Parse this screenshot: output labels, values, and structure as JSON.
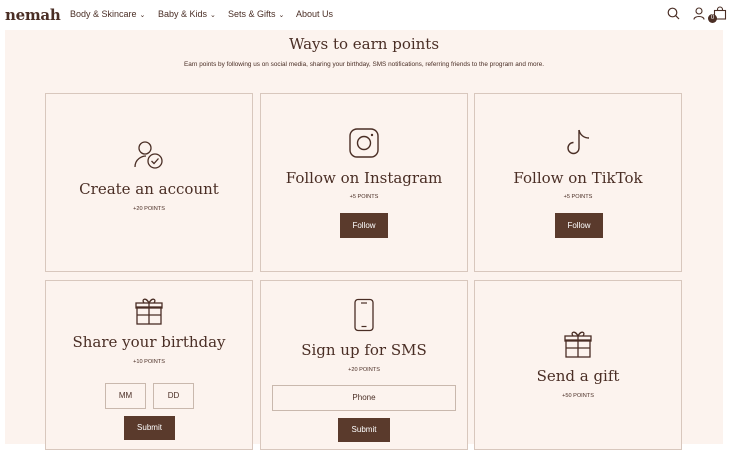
{
  "header": {
    "logo": "nemah",
    "nav": [
      {
        "label": "Body & Skincare",
        "chevron": "⌄"
      },
      {
        "label": "Baby & Kids",
        "chevron": "⌄"
      },
      {
        "label": "Sets & Gifts",
        "chevron": "⌄"
      },
      {
        "label": "About Us"
      }
    ],
    "icons": [
      "search-icon",
      "account-icon",
      "bag-icon"
    ],
    "cart_count": "0"
  },
  "main": {
    "title": "Ways to earn points",
    "subtitle": "Earn points by following us on social media, sharing your birthday, SMS notifications, referring friends to the program and more."
  },
  "cards": {
    "account": {
      "title": "Create an account",
      "points": "+20 POINTS",
      "icon": "user-check-icon"
    },
    "instagram": {
      "title": "Follow on Instagram",
      "points": "+5 POINTS",
      "button": "Follow",
      "icon": "instagram-icon"
    },
    "tiktok": {
      "title": "Follow on TikTok",
      "points": "+5 POINTS",
      "button": "Follow",
      "icon": "tiktok-icon"
    },
    "birthday": {
      "title": "Share your birthday",
      "points": "+10 POINTS",
      "month_placeholder": "MM",
      "day_placeholder": "DD",
      "button": "Submit",
      "icon": "gift-icon"
    },
    "sms": {
      "title": "Sign up for SMS",
      "points": "+20 POINTS",
      "phone_placeholder": "Phone",
      "button": "Submit",
      "icon": "phone-icon"
    },
    "gift": {
      "title": "Send a gift",
      "points": "+50 POINTS",
      "icon": "gift-icon"
    }
  },
  "colors": {
    "brand": "#4a2e25",
    "button": "#5a3a2c",
    "background": "#fcf3ee",
    "border": "#d8c7bd"
  }
}
